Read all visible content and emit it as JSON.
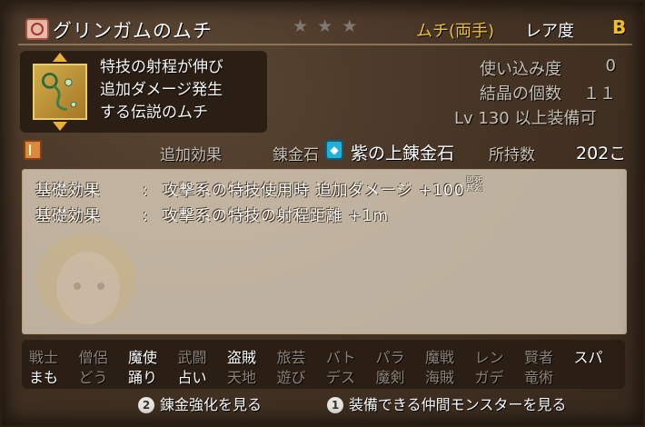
{
  "item": {
    "name": "グリンガムのムチ",
    "stars": [
      "★",
      "★",
      "★"
    ],
    "weapon_type": "ムチ(両手)",
    "rarity_label": "レア度",
    "rarity": "B",
    "description": [
      "特技の射程が伸び",
      "追加ダメージ発生",
      "する伝説のムチ"
    ]
  },
  "stats": {
    "usage_label": "使い込み度",
    "usage_value": "0",
    "crystal_label": "結晶の個数",
    "crystal_value": "１１",
    "level_req": "Lv 130 以上装備可"
  },
  "alchemy": {
    "extra_effect_label": "追加効果",
    "stone_label": "錬金石",
    "stone_name": "紫の上錬金石",
    "owned_label": "所持数",
    "owned_value": "202こ"
  },
  "effects": [
    {
      "label": "基礎効果",
      "text": "攻撃系の特技使用時 追加ダメージ +100",
      "badge": "即死 無効"
    },
    {
      "label": "基礎効果",
      "text": "攻撃系の特技の射程距離 +1m",
      "badge": ""
    }
  ],
  "jobs_row1": [
    {
      "name": "戦士",
      "enabled": false
    },
    {
      "name": "僧侶",
      "enabled": false
    },
    {
      "name": "魔使",
      "enabled": true
    },
    {
      "name": "武闘",
      "enabled": false
    },
    {
      "name": "盗賊",
      "enabled": true
    },
    {
      "name": "旅芸",
      "enabled": false
    },
    {
      "name": "バト",
      "enabled": false
    },
    {
      "name": "パラ",
      "enabled": false
    },
    {
      "name": "魔戦",
      "enabled": false
    },
    {
      "name": "レン",
      "enabled": false
    },
    {
      "name": "賢者",
      "enabled": false
    },
    {
      "name": "スパ",
      "enabled": true
    }
  ],
  "jobs_row2": [
    {
      "name": "まも",
      "enabled": true
    },
    {
      "name": "どう",
      "enabled": false
    },
    {
      "name": "踊り",
      "enabled": true
    },
    {
      "name": "占い",
      "enabled": true
    },
    {
      "name": "天地",
      "enabled": false
    },
    {
      "name": "遊び",
      "enabled": false
    },
    {
      "name": "デス",
      "enabled": false
    },
    {
      "name": "魔剣",
      "enabled": false
    },
    {
      "name": "海賊",
      "enabled": false
    },
    {
      "name": "ガデ",
      "enabled": false
    },
    {
      "name": "竜術",
      "enabled": false
    }
  ],
  "buttons": {
    "btn2_key": "2",
    "btn2_label": "錬金強化を見る",
    "btn1_key": "1",
    "btn1_label": "装備できる仲間モンスターを見る"
  },
  "colors": {
    "accent_gold": "#f2c22c",
    "star_inactive": "#7f7a74",
    "job_disabled": "#8e8378"
  }
}
